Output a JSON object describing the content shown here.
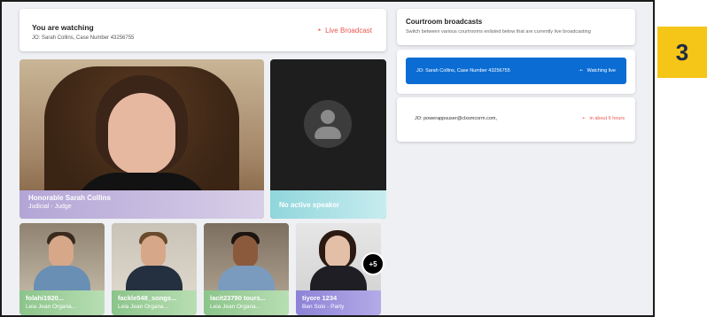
{
  "step_badge": "3",
  "watching": {
    "title": "You are watching",
    "subtitle": "JO: Sarah Collins, Case Number 43256755",
    "status": "Live Broadcast"
  },
  "main_video": {
    "name": "Honorable Sarah Collins",
    "role": "Judicial - Judge"
  },
  "speaker_tile": {
    "label": "No active speaker"
  },
  "participants": [
    {
      "name": "folahi1920...",
      "role": "Leia Jean Organa..."
    },
    {
      "name": "fackle548_songs...",
      "role": "Leia Jean Organa..."
    },
    {
      "name": "lacit23790 tours...",
      "role": "Leia Jean Organa..."
    },
    {
      "name": "tiyore 1234",
      "role": "Ben Solo - Party"
    }
  ],
  "more_count": "+5",
  "broadcasts": {
    "title": "Courtroom broadcasts",
    "subtitle": "Switch between various courtrooms enlisted below that are currently live broadcasting",
    "items": [
      {
        "label": "JO: Sarah Collins, Case Number 43256755",
        "status": "Watching live"
      },
      {
        "label": "JO: powerappsuser@clxsmcorm.com,",
        "status": "in about 6 hours"
      }
    ]
  },
  "colors": {
    "accent_blue": "#0b6dd4",
    "live_red": "#e8574f",
    "badge_yellow": "#f5c518"
  },
  "icons": {
    "live": "broadcast-icon",
    "avatar": "user-silhouette-icon"
  }
}
